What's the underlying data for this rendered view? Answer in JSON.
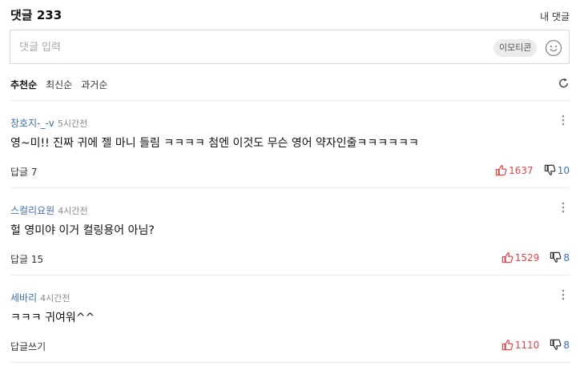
{
  "header": {
    "title": "댓글 233",
    "my_comments": "내 댓글"
  },
  "input": {
    "placeholder": "댓글 입력",
    "emoticon_label": "이모티콘"
  },
  "sort": {
    "tabs": [
      "추천순",
      "최신순",
      "과거순"
    ],
    "active": "추천순"
  },
  "comments": [
    {
      "author": "창호지-_-v",
      "time": "5시간전",
      "text": "영~미!!  진짜 귀에 젤 마니 들림 ㅋㅋㅋㅋ  첨엔 이것도 무슨 영어 약자인줄ㅋㅋㅋㅋㅋㅋ",
      "reply": "답글 7",
      "likes": "1637",
      "dislikes": "10"
    },
    {
      "author": "스컬리요원",
      "time": "4시간전",
      "text": "헐 영미야 이거 컬링용어 아님?",
      "reply": "답글 15",
      "likes": "1529",
      "dislikes": "8"
    },
    {
      "author": "세바리",
      "time": "4시간전",
      "text": "ㅋㅋㅋ 귀여워^^",
      "reply": "답글쓰기",
      "likes": "1110",
      "dislikes": "8"
    }
  ],
  "colors": {
    "author": "#3f6fb5",
    "like": "#e0454b",
    "dislike": "#3f6fb5"
  },
  "icons": {
    "like": "thumbs-up-icon",
    "dislike": "thumbs-down-icon",
    "more": "more-vertical-icon",
    "refresh": "refresh-icon",
    "emoji": "smiley-icon"
  }
}
